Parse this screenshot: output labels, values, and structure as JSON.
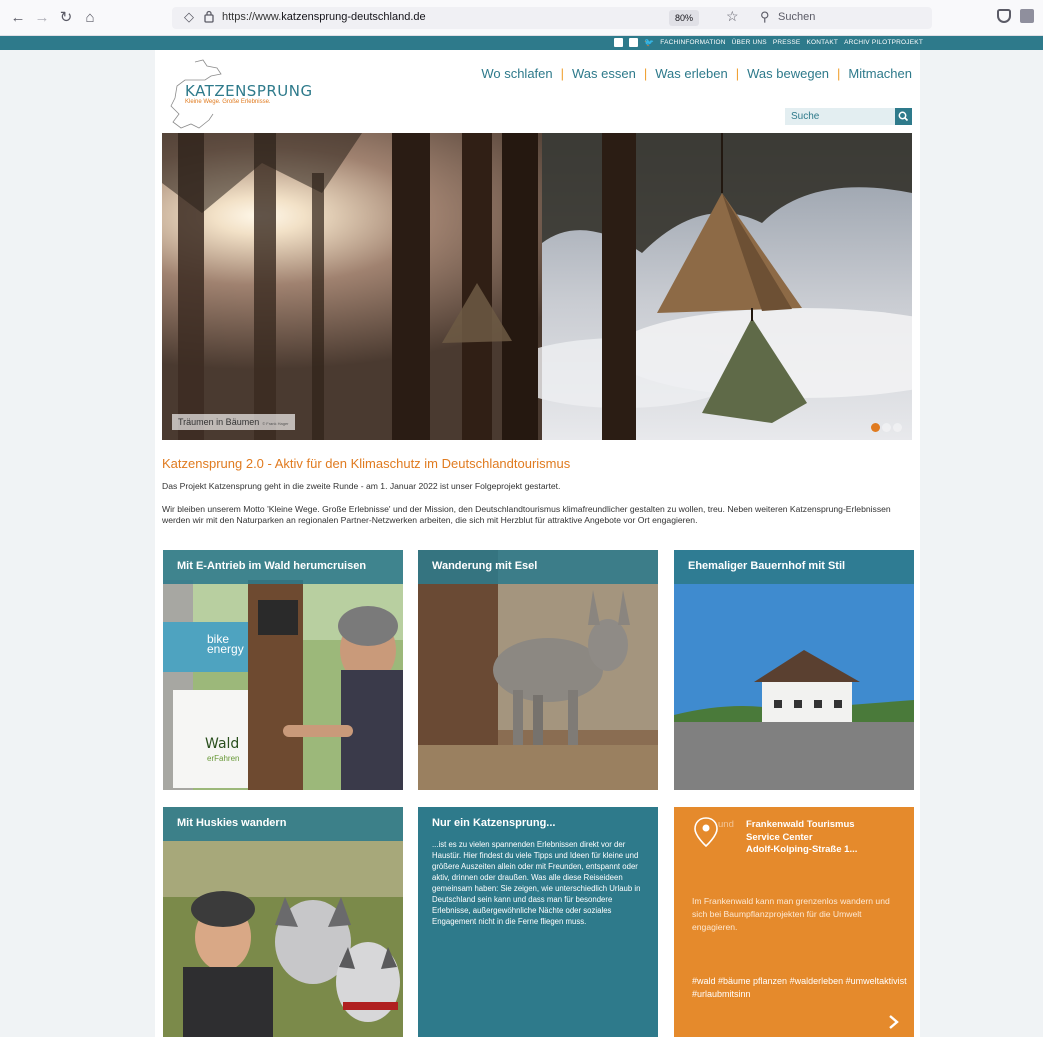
{
  "browser": {
    "url_prefix": "https://www.",
    "url_domain": "katzensprung-deutschland.de",
    "zoom": "80%",
    "search_placeholder": "Suchen"
  },
  "topbar": {
    "social_icons": [
      "facebook-icon",
      "instagram-icon",
      "twitter-icon"
    ],
    "links": [
      "FACHINFORMATION",
      "ÜBER UNS",
      "PRESSE",
      "KONTAKT",
      "ARCHIV PILOTPROJEKT"
    ]
  },
  "logo": {
    "title": "KATZENSPRUNG",
    "tagline": "Kleine Wege. Große Erlebnisse."
  },
  "nav": {
    "items": [
      "Wo schlafen",
      "Was essen",
      "Was erleben",
      "Was bewegen",
      "Mitmachen"
    ]
  },
  "site_search": {
    "placeholder": "Suche"
  },
  "hero": {
    "caption": "Träumen in Bäumen",
    "credit": "© Frank Hager",
    "slide_count": 3,
    "active_slide": 1
  },
  "intro": {
    "title": "Katzensprung 2.0 - Aktiv für den Klimaschutz im Deutschlandtourismus",
    "p1": "Das Projekt Katzensprung geht in die zweite Runde - am 1. Januar 2022 ist unser Folgeprojekt gestartet.",
    "p2": "Wir bleiben unserem Motto 'Kleine Wege. Große Erlebnisse' und der Mission, den Deutschlandtourismus klimafreundlicher gestalten zu wollen, treu. Neben weiteren Katzensprung-Erlebnissen werden wir mit den Naturparken an regionalen Partner-Netzwerken arbeiten, die sich mit Herzblut für attraktive Angebote vor Ort engagieren."
  },
  "cards": [
    {
      "title": "Mit E-Antrieb im Wald herumcruisen",
      "sign_brand_1": "bike",
      "sign_brand_2": "energy",
      "sign_text_1": "Wald",
      "sign_text_2": "erFahren"
    },
    {
      "title": "Wanderung mit Esel"
    },
    {
      "title": "Ehemaliger Bauernhof mit Stil"
    },
    {
      "title": "Mit Huskies wandern"
    },
    {
      "title": "Nur ein Katzensprung...",
      "body": "...ist es zu vielen spannenden Erlebnissen direkt vor der Haustür. Hier findest du viele Tipps und Ideen für kleine und größere Auszeiten allein oder mit Freunden, entspannt oder aktiv, drinnen oder draußen. Was alle diese Reiseideen gemeinsam haben: Sie zeigen, wie unterschiedlich Urlaub in Deutschland sein kann und dass man für besondere Erlebnisse, außergewöhnliche Nächte oder soziales Engagement nicht in die Ferne fliegen muss."
    },
    {
      "faint_prefix": "und",
      "org_line1": "Frankenwald Tourismus",
      "org_line2": "Service Center",
      "org_line3": "Adolf-Kolping-Straße 1...",
      "text": "Im Frankenwald kann man grenzenlos wandern und sich bei Baumpflanzprojekten für die Umwelt engagieren.",
      "tags": "#wald #bäume pflanzen #walderleben #umweltaktivist #urlaubmitsinn"
    }
  ],
  "colors": {
    "teal": "#2e7a8b",
    "orange": "#e07b20"
  }
}
